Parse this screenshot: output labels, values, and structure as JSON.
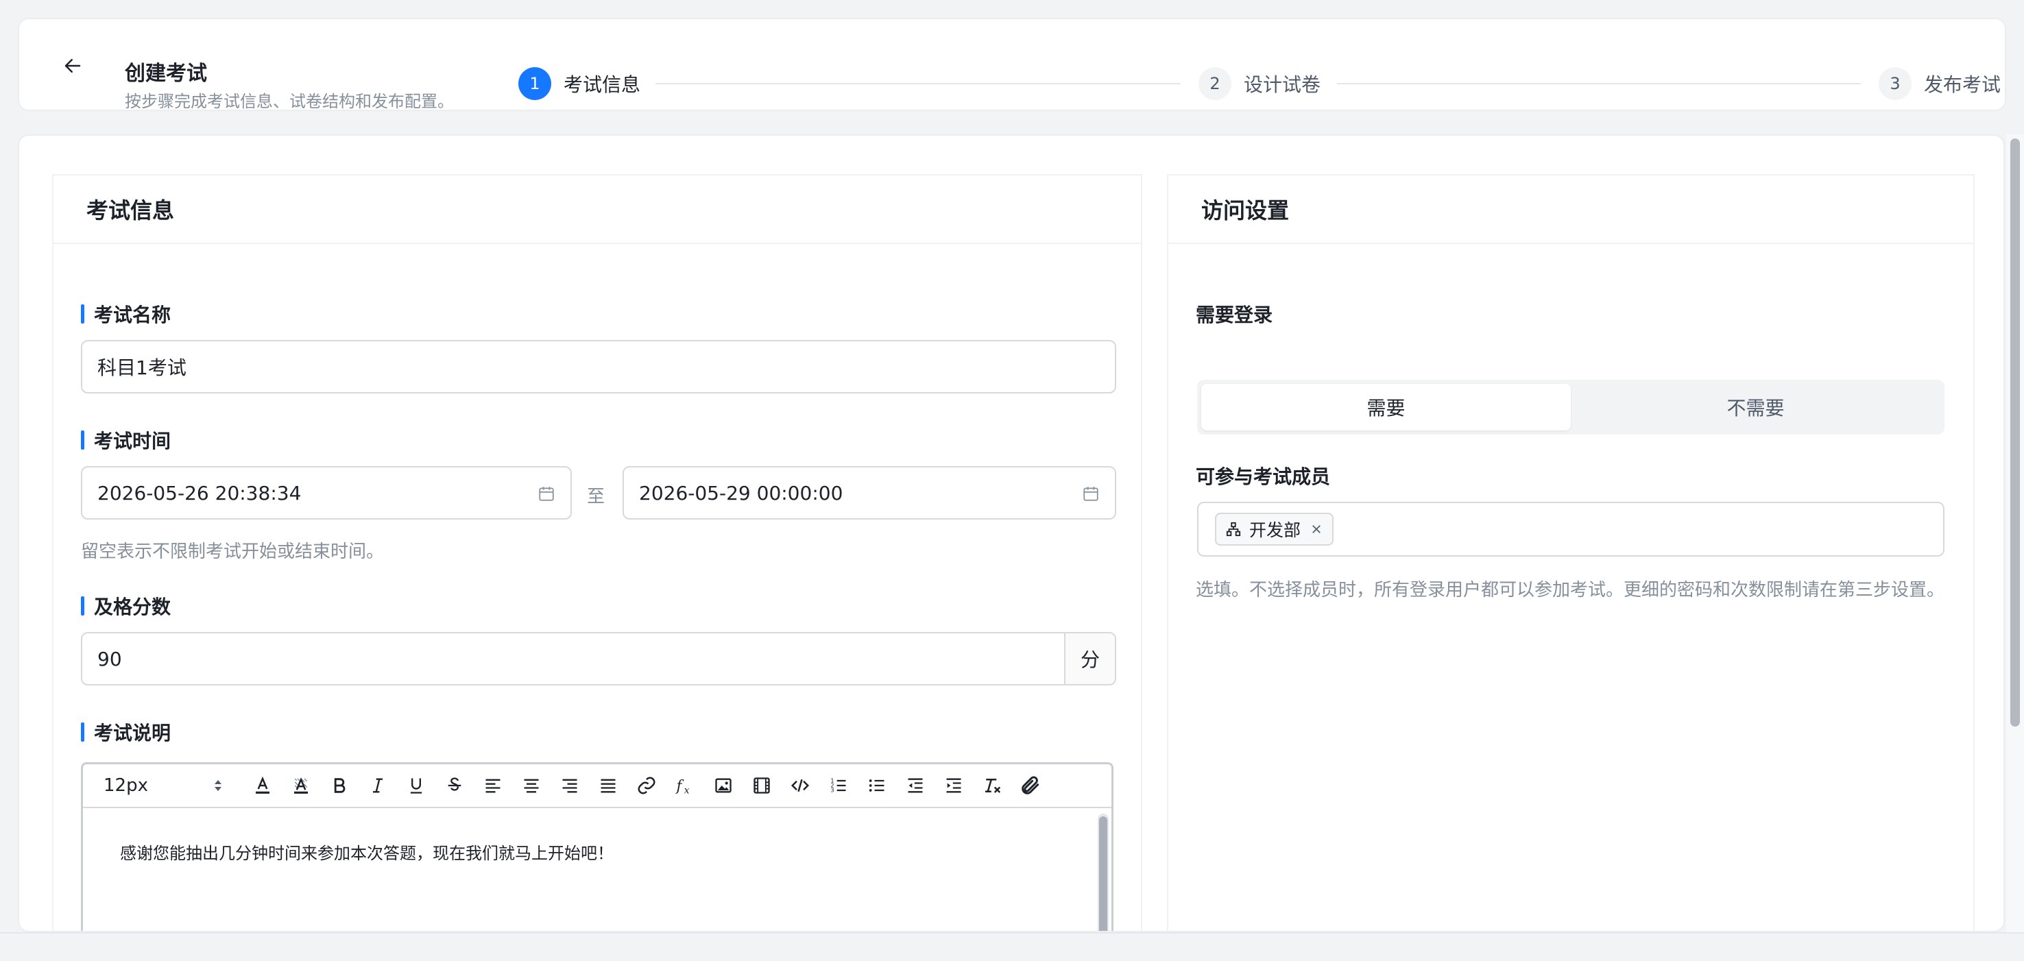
{
  "header": {
    "title": "创建考试",
    "subtitle": "按步骤完成考试信息、试卷结构和发布配置。",
    "steps": [
      {
        "num": "1",
        "label": "考试信息"
      },
      {
        "num": "2",
        "label": "设计试卷"
      },
      {
        "num": "3",
        "label": "发布考试"
      }
    ]
  },
  "exam_info": {
    "panel_title": "考试信息",
    "name_label": "考试名称",
    "name_value": "科目1考试",
    "time_label": "考试时间",
    "start_time": "2026-05-26 20:38:34",
    "range_separator": "至",
    "end_time": "2026-05-29 00:00:00",
    "time_hint": "留空表示不限制考试开始或结束时间。",
    "pass_label": "及格分数",
    "pass_value": "90",
    "pass_unit": "分",
    "desc_label": "考试说明",
    "editor": {
      "font_size": "12px",
      "content": "感谢您能抽出几分钟时间来参加本次答题，现在我们就马上开始吧！"
    }
  },
  "access": {
    "panel_title": "访问设置",
    "login_label": "需要登录",
    "login_options": [
      "需要",
      "不需要"
    ],
    "members_label": "可参与考试成员",
    "member_tags": [
      "开发部"
    ],
    "members_hint": "选填。不选择成员时，所有登录用户都可以参加考试。更细的密码和次数限制请在第三步设置。"
  },
  "colors": {
    "primary": "#1677ff",
    "text": "#1d2129",
    "muted": "#86909c"
  }
}
